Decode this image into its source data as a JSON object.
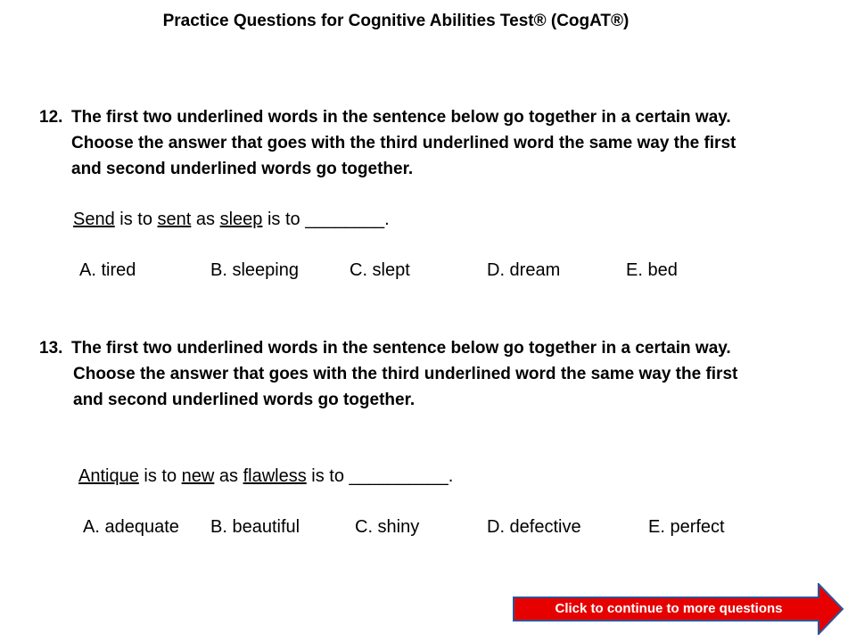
{
  "page": {
    "title": "Practice Questions for Cognitive Abilities Test® (CogAT®)"
  },
  "questions": [
    {
      "number": "12.",
      "prompt_lines": [
        "The first two underlined words in the sentence below go together in a certain way.",
        "Choose the answer that goes with the third underlined word the same way the first",
        "and second underlined words go together."
      ],
      "sentence": {
        "w1": "Send",
        "t1": " is to ",
        "w2": "sent",
        "t2": " as ",
        "w3": "sleep",
        "t3": " is to ",
        "blank": "________",
        "end": "."
      },
      "options": [
        "A.  tired",
        "B.  sleeping",
        "C.  slept",
        "D.  dream",
        "E.  bed"
      ]
    },
    {
      "number": "13.",
      "prompt_lines": [
        "The first two underlined words in the sentence below go together in a certain way.",
        "Choose the answer that goes with the third underlined word the same way the first",
        "and second underlined words go together."
      ],
      "sentence": {
        "w1": "Antique",
        "t1": " is to ",
        "w2": "new",
        "t2": " as ",
        "w3": "flawless",
        "t3": " is to ",
        "blank": "__________",
        "end": "."
      },
      "options": [
        "A.  adequate",
        "B.  beautiful",
        "C.  shiny",
        "D.  defective",
        "E.  perfect"
      ]
    }
  ],
  "continue_button": {
    "label": "Click to continue to more questions",
    "fill_color": "#e60000",
    "border_color": "#2f5597"
  }
}
